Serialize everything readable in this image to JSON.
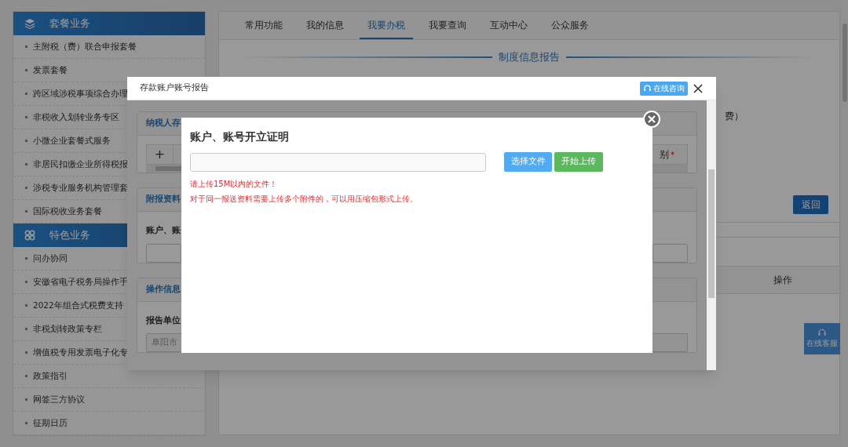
{
  "sidebar": {
    "sections": [
      {
        "title": "套餐业务",
        "items": [
          "主附税（费）联合申报套餐",
          "发票套餐",
          "跨区域涉税事项综合办理",
          "非税收入划转业务专区",
          "小微企业套餐式服务",
          "非居民扣缴企业所得税报",
          "涉税专业服务机构管理套",
          "国际税收业务套餐"
        ]
      },
      {
        "title": "特色业务",
        "items": [
          "问办协同",
          "安徽省电子税务局操作手",
          "2022年组合式税费支持",
          "非税划转政策专栏",
          "增值税专用发票电子化专",
          "政策指引",
          "网签三方协议",
          "征期日历"
        ]
      }
    ]
  },
  "main": {
    "tabs": [
      {
        "label": "常用功能",
        "selected": false
      },
      {
        "label": "我的信息",
        "selected": false
      },
      {
        "label": "我要办税",
        "selected": true
      },
      {
        "label": "我要查询",
        "selected": false
      },
      {
        "label": "互动中心",
        "selected": false
      },
      {
        "label": "公众服务",
        "selected": false
      }
    ],
    "section_title": "制度信息报告",
    "fragment": "费）",
    "back_button": "返回",
    "table_header": "操作"
  },
  "chat_button": "在线客服",
  "report_dialog": {
    "title": "存款账户账号报告",
    "consult_button": "在线咨询",
    "panels": [
      {
        "title": "纳税人存",
        "add_button": "+",
        "column_label": "别",
        "required_mark": "*"
      },
      {
        "title": "附报资料",
        "label": "账户、账"
      },
      {
        "title": "操作信息",
        "label": "报告单位",
        "field_value": "阜阳市"
      }
    ]
  },
  "upload_dialog": {
    "title": "账户、账号开立证明",
    "select_button": "选择文件",
    "upload_button": "开始上传",
    "notes": [
      "请上传15M以内的文件！",
      "对于同一报送资料需要上传多个附件的，可以用压缩包形式上传。"
    ]
  }
}
